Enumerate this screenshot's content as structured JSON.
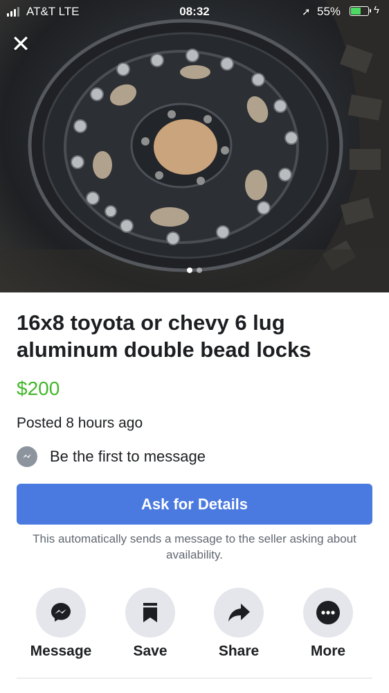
{
  "status_bar": {
    "carrier": "AT&T  LTE",
    "time": "08:32",
    "battery": "55%"
  },
  "photo": {
    "description_icon": "wheel-photo",
    "page_count": 2,
    "active_page": 1
  },
  "listing": {
    "title": "16x8 toyota or chevy 6 lug aluminum double bead locks",
    "price": "$200",
    "posted": "Posted 8 hours ago",
    "first_message": "Be the first to message",
    "price_color": "#42b72a"
  },
  "ask": {
    "button_label": "Ask for Details",
    "note": "This automatically sends a message to the seller asking about availability.",
    "button_color": "#4a7ae0"
  },
  "actions": [
    {
      "label": "Message",
      "icon": "messenger-icon"
    },
    {
      "label": "Save",
      "icon": "bookmark-icon"
    },
    {
      "label": "Share",
      "icon": "share-arrow-icon"
    },
    {
      "label": "More",
      "icon": "more-dots-icon"
    }
  ]
}
